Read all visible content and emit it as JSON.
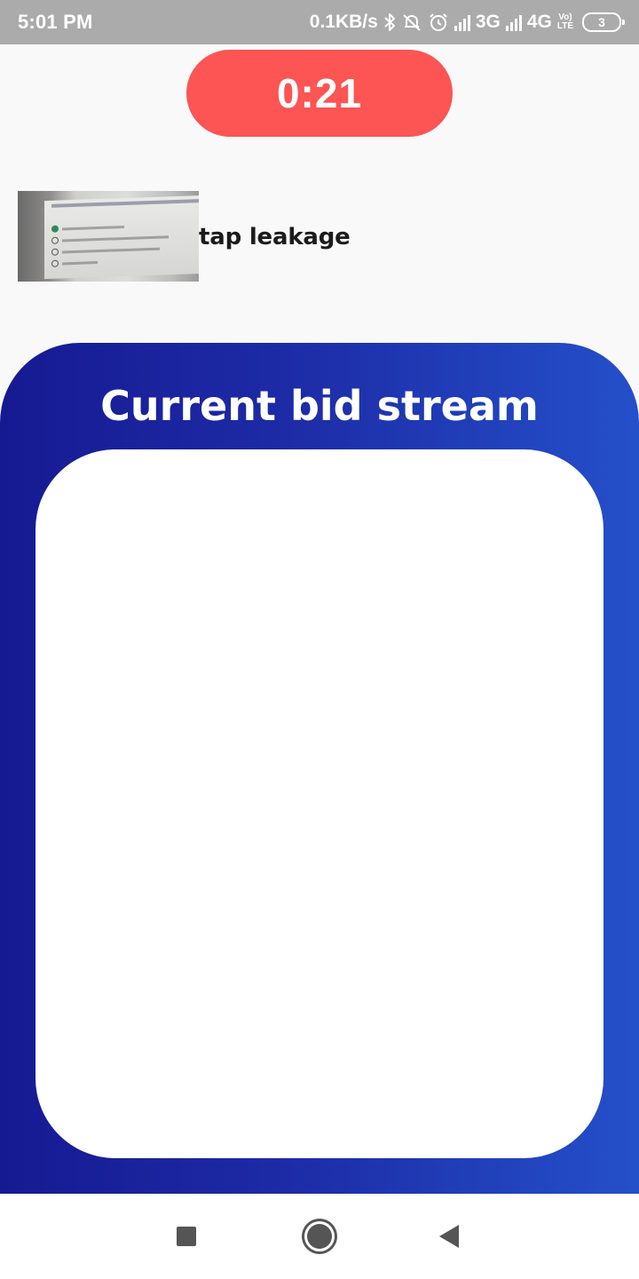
{
  "status_bar": {
    "time": "5:01 PM",
    "net_speed": "0.1KB/s",
    "network_1": "3G",
    "network_2": "4G",
    "volte_top": "Vo)",
    "volte_bottom": "LTE",
    "battery": "3",
    "icons": [
      "bluetooth-icon",
      "muted-bell-icon",
      "alarm-icon",
      "signal-icon",
      "signal-icon",
      "volte-icon",
      "battery-icon"
    ]
  },
  "timer": {
    "value": "0:21",
    "color": "#fd5454"
  },
  "product": {
    "name": "tap leakage"
  },
  "bid_stream": {
    "title": "Current bid stream",
    "gradient_start": "#161a92",
    "gradient_end": "#2450ca"
  },
  "nav_bar": {
    "buttons": [
      "recents-icon",
      "home-icon",
      "back-icon"
    ]
  }
}
